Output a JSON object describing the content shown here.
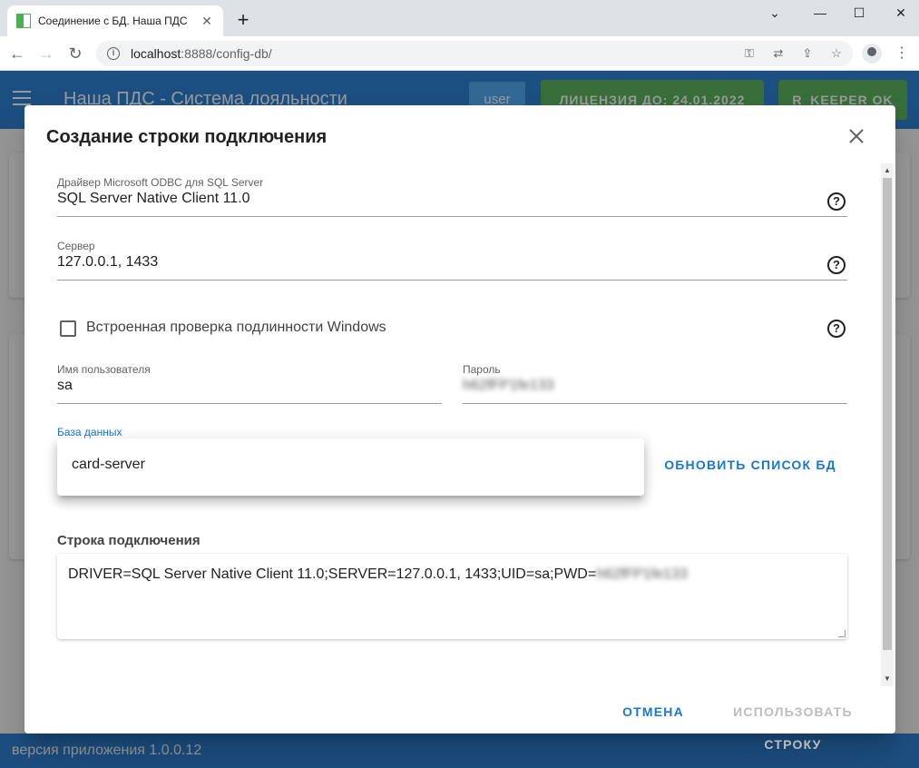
{
  "browser": {
    "tab_title": "Соединение с БД. Наша ПДС",
    "url_host": "localhost",
    "url_rest": ":8888/config-db/"
  },
  "app": {
    "title": "Наша ПДС - Система лояльности",
    "user_label": "user",
    "license_label": "ЛИЦЕНЗИЯ ДО: 24.01.2022",
    "rkeeper_label": "R_KEEPER OK",
    "version_label": "версия приложения 1.0.0.12",
    "accent_color": "#1976d2",
    "ok_color": "#4caf50"
  },
  "dialog": {
    "title": "Создание строки подключения",
    "driver": {
      "label": "Драйвер Microsoft ODBC для SQL Server",
      "value": "SQL Server Native Client 11.0"
    },
    "server": {
      "label": "Сервер",
      "value": "127.0.0.1, 1433"
    },
    "windows_auth": {
      "label": "Встроенная проверка подлинности Windows",
      "checked": false
    },
    "username": {
      "label": "Имя пользователя",
      "value": "sa"
    },
    "password": {
      "label": "Пароль",
      "value": "h62fFP1fe133"
    },
    "database": {
      "label": "База данных",
      "options": [
        "card-server"
      ]
    },
    "refresh_label": "ОБНОВИТЬ СПИСОК БД",
    "connection_string": {
      "label": "Строка подключения",
      "value_visible": "DRIVER=SQL Server Native Client 11.0;SERVER=127.0.0.1, 1433;UID=sa;PWD=",
      "value_hidden": "h62fFP1fe133"
    },
    "cancel_label": "ОТМЕНА",
    "use_label": "ИСПОЛЬЗОВАТЬ СТРОКУ"
  }
}
